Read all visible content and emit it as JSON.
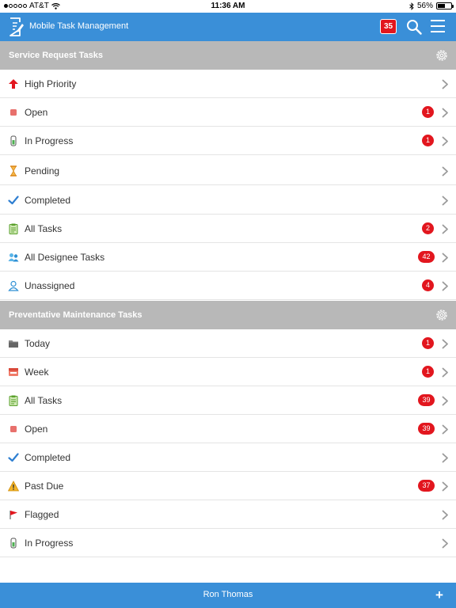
{
  "status_bar": {
    "carrier": "AT&T",
    "time": "11:36 AM",
    "battery": "56%",
    "battery_level": 0.56
  },
  "header": {
    "app_title": "Mobile Task Management",
    "notification_count": "35"
  },
  "service_request": {
    "title": "Service Request Tasks",
    "items": [
      {
        "label": "High Priority",
        "icon": "up-arrow-icon",
        "badge": ""
      },
      {
        "label": "Open",
        "icon": "open-square-icon",
        "badge": "1"
      },
      {
        "label": "In Progress",
        "icon": "battery-progress-icon",
        "badge": "1"
      },
      {
        "label": "Pending",
        "icon": "hourglass-icon",
        "badge": ""
      },
      {
        "label": "Completed",
        "icon": "checkmark-icon",
        "badge": ""
      },
      {
        "label": "All Tasks",
        "icon": "clipboard-icon",
        "badge": "2"
      },
      {
        "label": "All Designee Tasks",
        "icon": "group-users-icon",
        "badge": "42"
      },
      {
        "label": "Unassigned",
        "icon": "user-outline-icon",
        "badge": "4"
      }
    ]
  },
  "preventative_maintenance": {
    "title": "Preventative Maintenance Tasks",
    "items": [
      {
        "label": "Today",
        "icon": "folder-icon",
        "badge": "1"
      },
      {
        "label": "Week",
        "icon": "week-calendar-icon",
        "badge": "1"
      },
      {
        "label": "All Tasks",
        "icon": "clipboard-icon",
        "badge": "39"
      },
      {
        "label": "Open",
        "icon": "open-square-icon",
        "badge": "39"
      },
      {
        "label": "Completed",
        "icon": "checkmark-icon",
        "badge": ""
      },
      {
        "label": "Past Due",
        "icon": "warning-triangle-icon",
        "badge": "37"
      },
      {
        "label": "Flagged",
        "icon": "flag-icon",
        "badge": ""
      },
      {
        "label": "In Progress",
        "icon": "battery-progress-icon",
        "badge": ""
      }
    ]
  },
  "footer": {
    "user_name": "Ron Thomas",
    "add_label": "+"
  },
  "colors": {
    "primary": "#3a8fd8",
    "section_header": "#b8b8b8",
    "badge": "#e2161e"
  }
}
